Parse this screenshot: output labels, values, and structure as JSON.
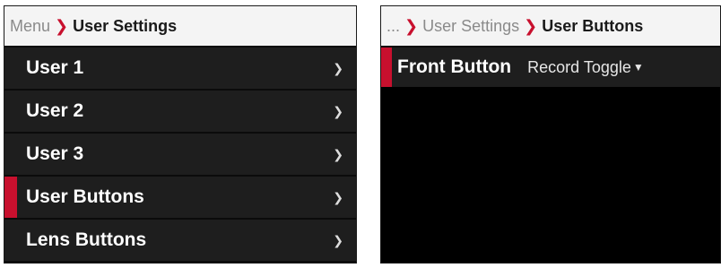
{
  "left": {
    "breadcrumb": {
      "root": "Menu",
      "current": "User Settings"
    },
    "items": [
      {
        "label": "User 1"
      },
      {
        "label": "User 2"
      },
      {
        "label": "User 3"
      },
      {
        "label": "User Buttons"
      },
      {
        "label": "Lens Buttons"
      }
    ],
    "selected_index": 3
  },
  "right": {
    "breadcrumb": {
      "ellipsis": "...",
      "parent": "User Settings",
      "current": "User Buttons"
    },
    "setting": {
      "label": "Front Button",
      "value": "Record Toggle"
    }
  },
  "icons": {
    "breadcrumb_separator": "chevron-right-icon",
    "item_chevron": "chevron-right-icon",
    "dropdown": "caret-down-icon"
  },
  "colors": {
    "accent": "#c8102e",
    "panel_bg": "#1e1e1e",
    "breadcrumb_bg": "#f4f4f4"
  }
}
